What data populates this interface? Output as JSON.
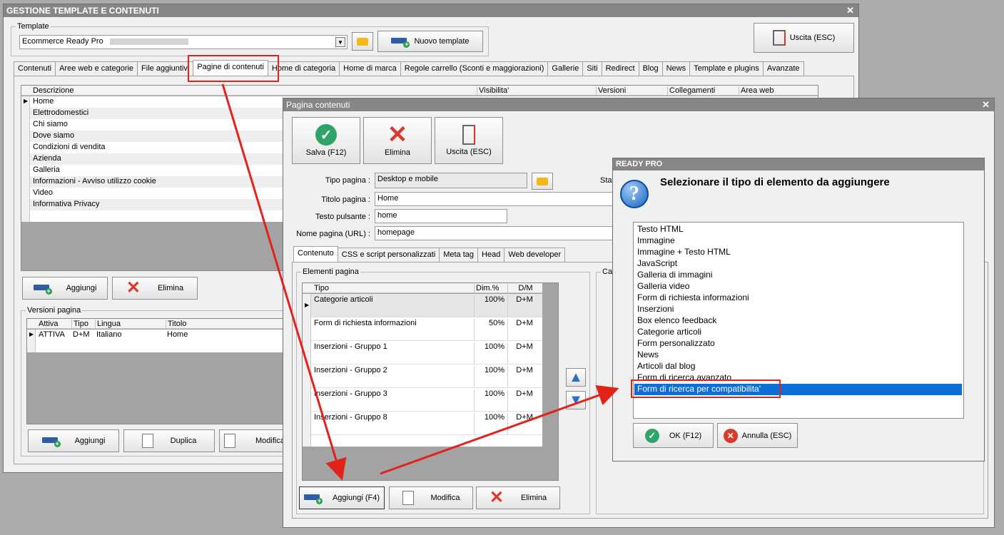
{
  "main": {
    "title": "GESTIONE TEMPLATE E CONTENUTI",
    "close": "✕",
    "template_group": "Template",
    "template_value": "Ecommerce Ready Pro",
    "nuovo_template": "Nuovo template",
    "uscita": "Uscita (ESC)",
    "tabs": [
      "Contenuti",
      "Aree web e categorie",
      "File aggiuntivi",
      "Pagine di contenuti",
      "Home di categoria",
      "Home di marca",
      "Regole carrello (Sconti e maggiorazioni)",
      "Gallerie",
      "Siti",
      "Redirect",
      "Blog",
      "News",
      "Template e plugins",
      "Avanzate"
    ],
    "active_tab": "Pagine di contenuti",
    "pages_headers": [
      "Descrizione",
      "Visibilita'",
      "Versioni",
      "Collegamenti",
      "Area web"
    ],
    "pages_rows": [
      "Home",
      "Elettrodomestici",
      "Chi siamo",
      "Dove siamo",
      "Condizioni di vendita",
      "Azienda",
      "Galleria",
      "Informazioni - Avviso utilizzo cookie",
      "Video",
      "Informativa Privacy"
    ],
    "aggiungi": "Aggiungi",
    "elimina": "Elimina",
    "versions_group": "Versioni pagina",
    "versions_headers": [
      "Attiva",
      "Tipo",
      "Lingua",
      "Titolo"
    ],
    "versions_rows": [
      [
        "ATTIVA",
        "D+M",
        "Italiano",
        "Home"
      ]
    ],
    "v_aggiungi": "Aggiungi",
    "v_duplica": "Duplica",
    "v_modifica": "Modifica"
  },
  "pagina": {
    "title": "Pagina contenuti",
    "close": "✕",
    "salva": "Salva (F12)",
    "elimina": "Elimina",
    "uscita": "Uscita (ESC)",
    "tipo_label": "Tipo pagina :",
    "tipo_value": "Desktop e mobile",
    "stato_label": "Stat",
    "titolo_label": "Titolo pagina :",
    "titolo_value": "Home",
    "testo_label": "Testo pulsante :",
    "testo_value": "home",
    "nome_label": "Nome pagina (URL) :",
    "nome_value": "homepage",
    "tabs": [
      "Contenuto",
      "CSS e script personalizzati",
      "Meta tag",
      "Head",
      "Web developer"
    ],
    "elementi_group": "Elementi pagina",
    "cat_group": "Cat",
    "el_headers": [
      "Tipo",
      "Dim.%",
      "D/M"
    ],
    "el_rows": [
      [
        "Categorie articoli",
        "100%",
        "D+M"
      ],
      [
        "Form di richiesta informazioni",
        "50%",
        "D+M"
      ],
      [
        "Inserzioni - Gruppo 1",
        "100%",
        "D+M"
      ],
      [
        "Inserzioni - Gruppo 2",
        "100%",
        "D+M"
      ],
      [
        "Inserzioni - Gruppo 3",
        "100%",
        "D+M"
      ],
      [
        "Inserzioni - Gruppo 8",
        "100%",
        "D+M"
      ]
    ],
    "aggiungi_f4": "Aggiungi (F4)",
    "modifica": "Modifica",
    "elimina2": "Elimina"
  },
  "dialog": {
    "title": "READY PRO",
    "question": "Selezionare il tipo di elemento da aggiungere",
    "items": [
      "Testo HTML",
      "Immagine",
      "Immagine + Testo HTML",
      "JavaScript",
      "Galleria di immagini",
      "Galleria video",
      "Form di richiesta informazioni",
      "Inserzioni",
      "Box elenco feedback",
      "Categorie articoli",
      "Form personalizzato",
      "News",
      "Articoli dal blog",
      "Form di ricerca avanzato",
      "Form di ricerca per compatibilita'"
    ],
    "selected": "Form di ricerca per compatibilita'",
    "ok": "OK (F12)",
    "annulla": "Annulla (ESC)"
  },
  "colors": {
    "accent_select": "#0d6fd6",
    "annotation": "#e2231a",
    "ok_green": "#2fa36a",
    "cancel_red": "#d93a2c"
  }
}
